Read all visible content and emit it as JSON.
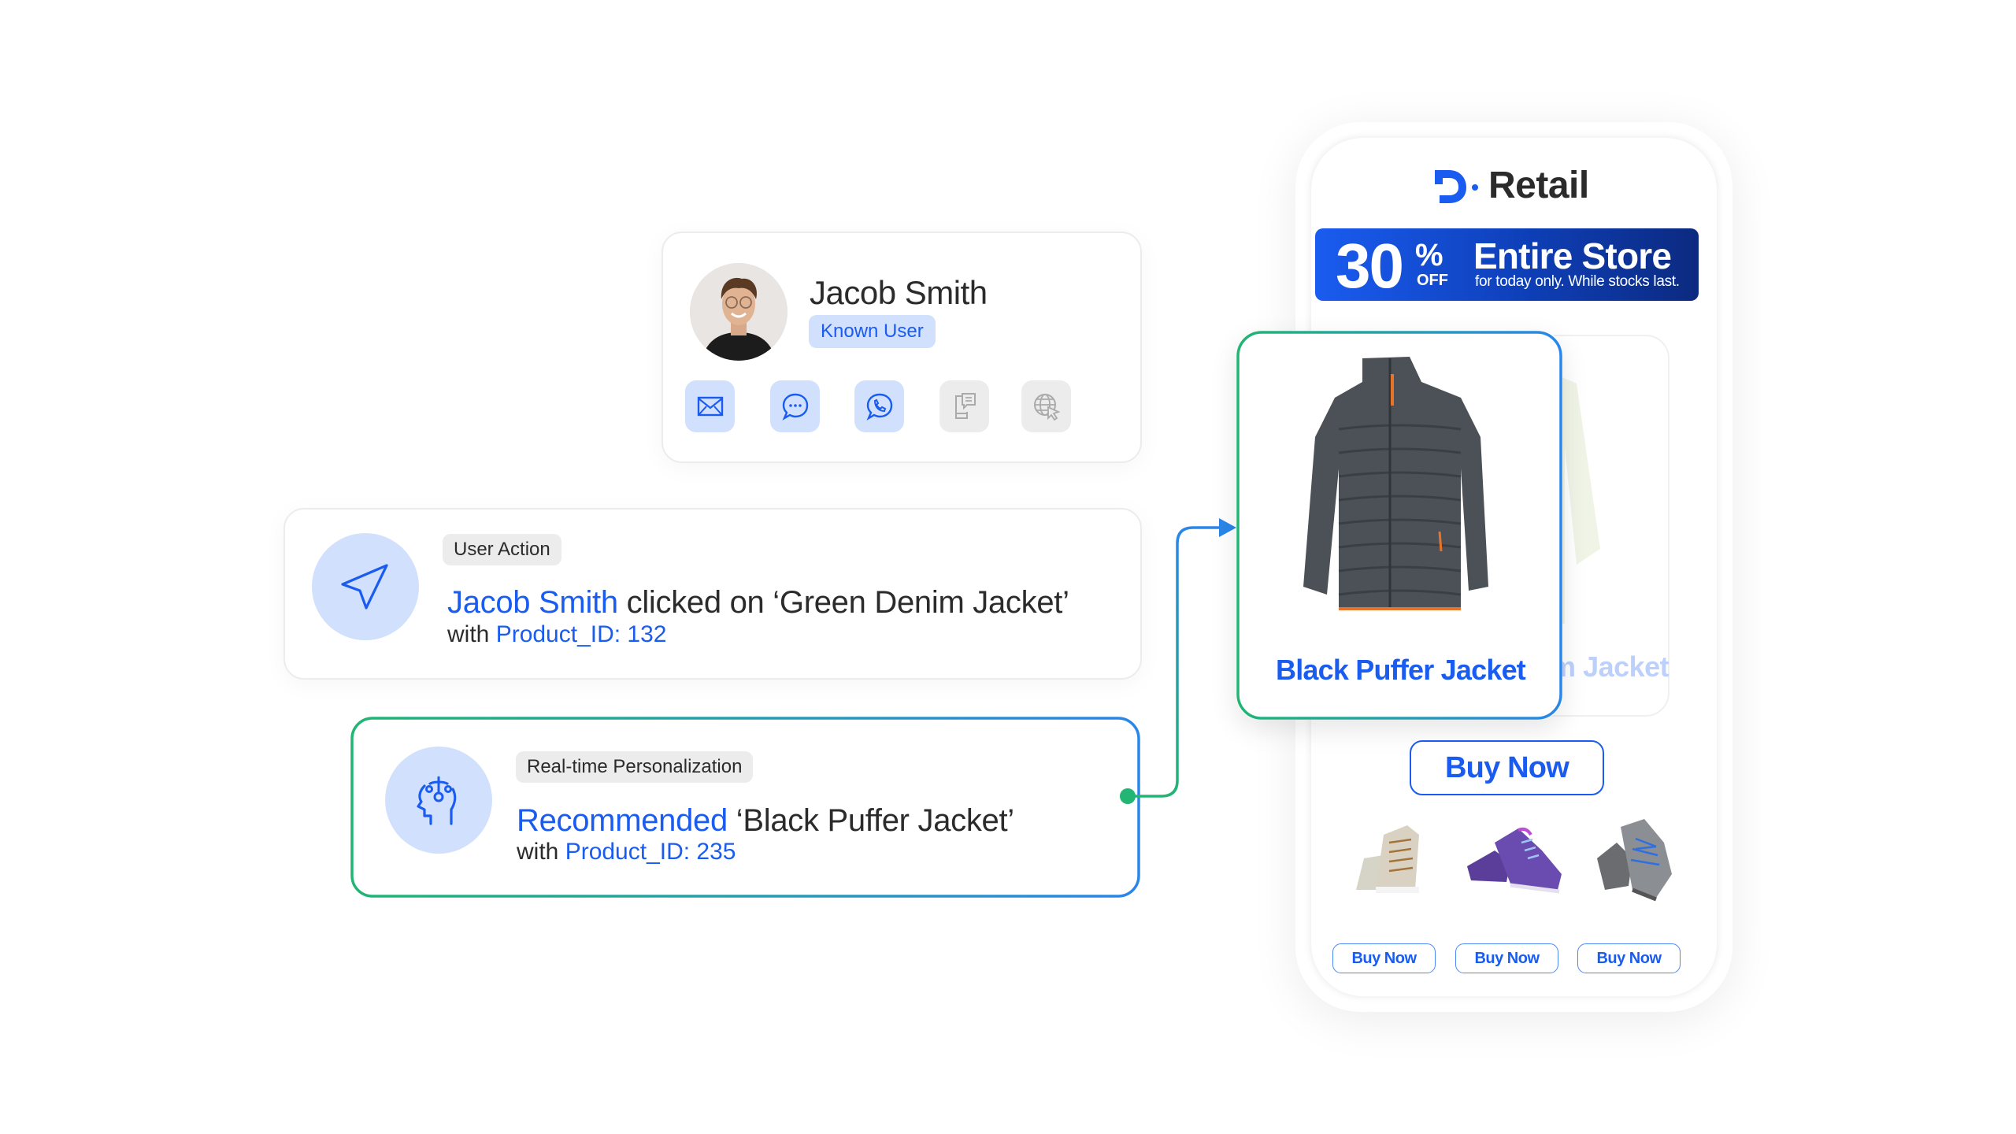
{
  "profile": {
    "name": "Jacob Smith",
    "badge": "Known User",
    "channels": [
      {
        "icon": "email-icon",
        "active": true
      },
      {
        "icon": "chat-icon",
        "active": true
      },
      {
        "icon": "whatsapp-icon",
        "active": true
      },
      {
        "icon": "mobile-message-icon",
        "active": false
      },
      {
        "icon": "web-click-icon",
        "active": false
      }
    ]
  },
  "user_action": {
    "tag": "User Action",
    "actor": "Jacob Smith",
    "text": " clicked on ‘Green Denim Jacket’",
    "with_label": "with ",
    "product_id": "Product_ID: 132",
    "icon": "navigation-arrow-icon"
  },
  "personalization": {
    "tag": "Real-time Personalization",
    "action": "Recommended",
    "text": " ‘Black Puffer Jacket’",
    "with_label": "with ",
    "product_id": "Product_ID: 235",
    "icon": "brain-head-icon"
  },
  "phone": {
    "brand": "Retail",
    "banner": {
      "discount": "30",
      "percent": "%",
      "off": "OFF",
      "title": "Entire Store",
      "subtitle": "for today only. While stocks last."
    },
    "featured_product": "Black Puffer Jacket",
    "previous_product": "Green Denim Jacket",
    "buy_now_label": "Buy Now",
    "related_products": [
      {
        "name": "beige-high-top-sneaker",
        "buy_label": "Buy Now"
      },
      {
        "name": "purple-running-shoe",
        "buy_label": "Buy Now"
      },
      {
        "name": "grey-hiking-shoe",
        "buy_label": "Buy Now"
      }
    ]
  },
  "colors": {
    "accent_blue": "#1a5cf0",
    "accent_green": "#22b573",
    "light_blue": "#d1e0fc",
    "banner_dark": "#0c2a80"
  }
}
